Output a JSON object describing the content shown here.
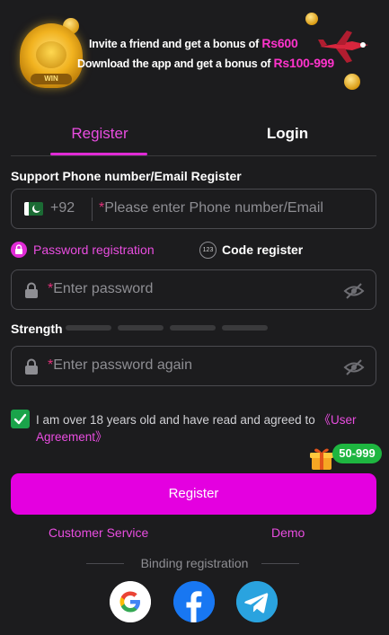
{
  "banner": {
    "line1_prefix": "Invite a friend and get a bonus of",
    "line1_amount": "Rs600",
    "line2_prefix": "Download the app and get a bonus of",
    "line2_amount": "Rs100-999",
    "lion_plate": "WIN"
  },
  "tabs": {
    "register": "Register",
    "login": "Login"
  },
  "form": {
    "section_title": "Support Phone number/Email Register",
    "country_code": "+92",
    "phone_placeholder": "Please enter Phone number/Email",
    "required_mark": "*",
    "mode_password": "Password registration",
    "mode_code": "Code register",
    "mode_code_icon": "123",
    "password_placeholder": "Enter password",
    "password_again_placeholder": "Enter password again",
    "strength_label": "Strength",
    "agree_text": "I am over 18 years old and have read and agreed to ",
    "agree_link": "《User Agreement》",
    "gift_badge": "50-999",
    "register_button": "Register"
  },
  "footer": {
    "customer_service": "Customer Service",
    "demo": "Demo",
    "binding": "Binding registration"
  },
  "colors": {
    "accent": "#e400e0",
    "check": "#1aa34a",
    "badge": "#1eb640"
  }
}
